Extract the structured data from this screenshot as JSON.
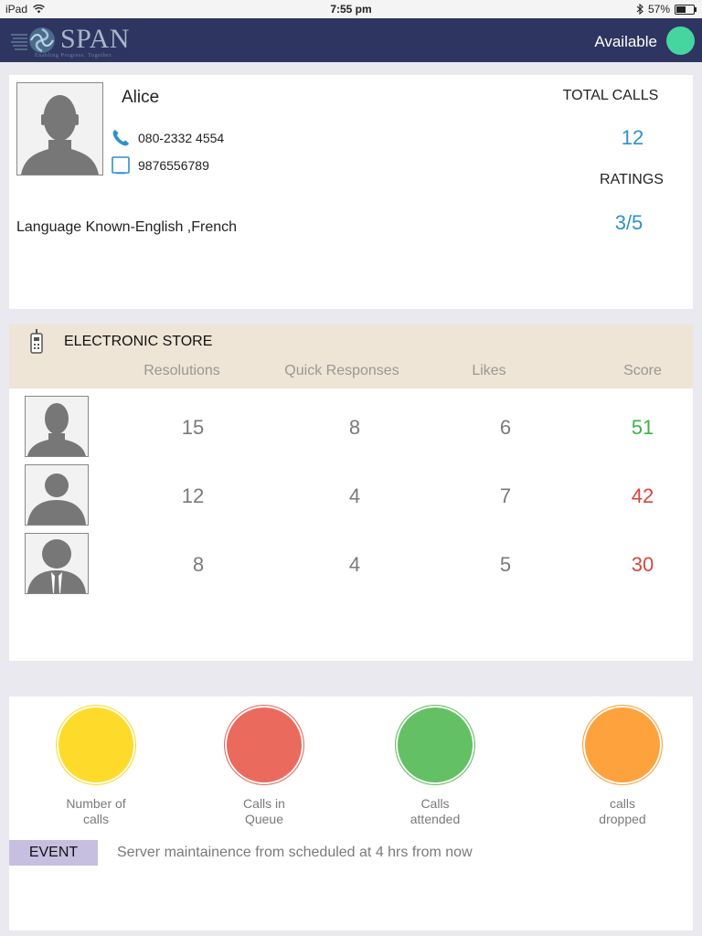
{
  "status_bar": {
    "carrier": "iPad",
    "time": "7:55 pm",
    "battery": "57%",
    "battery_level": 0.57
  },
  "header": {
    "logo_text": "SPAN",
    "logo_tagline": "Enabling Progress. Together.",
    "status_label": "Available",
    "status_color": "#45d6a0"
  },
  "profile": {
    "name": "Alice",
    "phone": "080-2332 4554",
    "mobile": "9876556789",
    "languages": "Language Known-English ,French",
    "total_calls_label": "TOTAL CALLS",
    "total_calls_value": "12",
    "ratings_label": "RATINGS",
    "ratings_value": "3/5",
    "accent_color": "#2e92c7"
  },
  "store": {
    "title": "ELECTRONIC STORE",
    "columns": [
      "Resolutions",
      "Quick Responses",
      "Likes",
      "Score"
    ],
    "rows": [
      {
        "avatar": "man-silhouette-icon",
        "resolutions": "15",
        "quick_responses": "8",
        "likes": "6",
        "score": "51",
        "score_color": "#3cb44a"
      },
      {
        "avatar": "person-silhouette-icon",
        "resolutions": "12",
        "quick_responses": "4",
        "likes": "7",
        "score": "42",
        "score_color": "#d9453e"
      },
      {
        "avatar": "person-tie-silhouette-icon",
        "resolutions": "8",
        "quick_responses": "4",
        "likes": "5",
        "score": "30",
        "score_color": "#d9453e"
      }
    ]
  },
  "stats": [
    {
      "label_line1": "Number of",
      "label_line2": "calls",
      "color": "#fedb2b"
    },
    {
      "label_line1": "Calls in",
      "label_line2": "Queue",
      "color": "#ea6a5e"
    },
    {
      "label_line1": "Calls",
      "label_line2": "attended",
      "color": "#64c064"
    },
    {
      "label_line1": "calls",
      "label_line2": "dropped",
      "color": "#fda23c"
    }
  ],
  "event": {
    "tag": "EVENT",
    "text": "Server maintainence from scheduled at 4 hrs from now"
  }
}
